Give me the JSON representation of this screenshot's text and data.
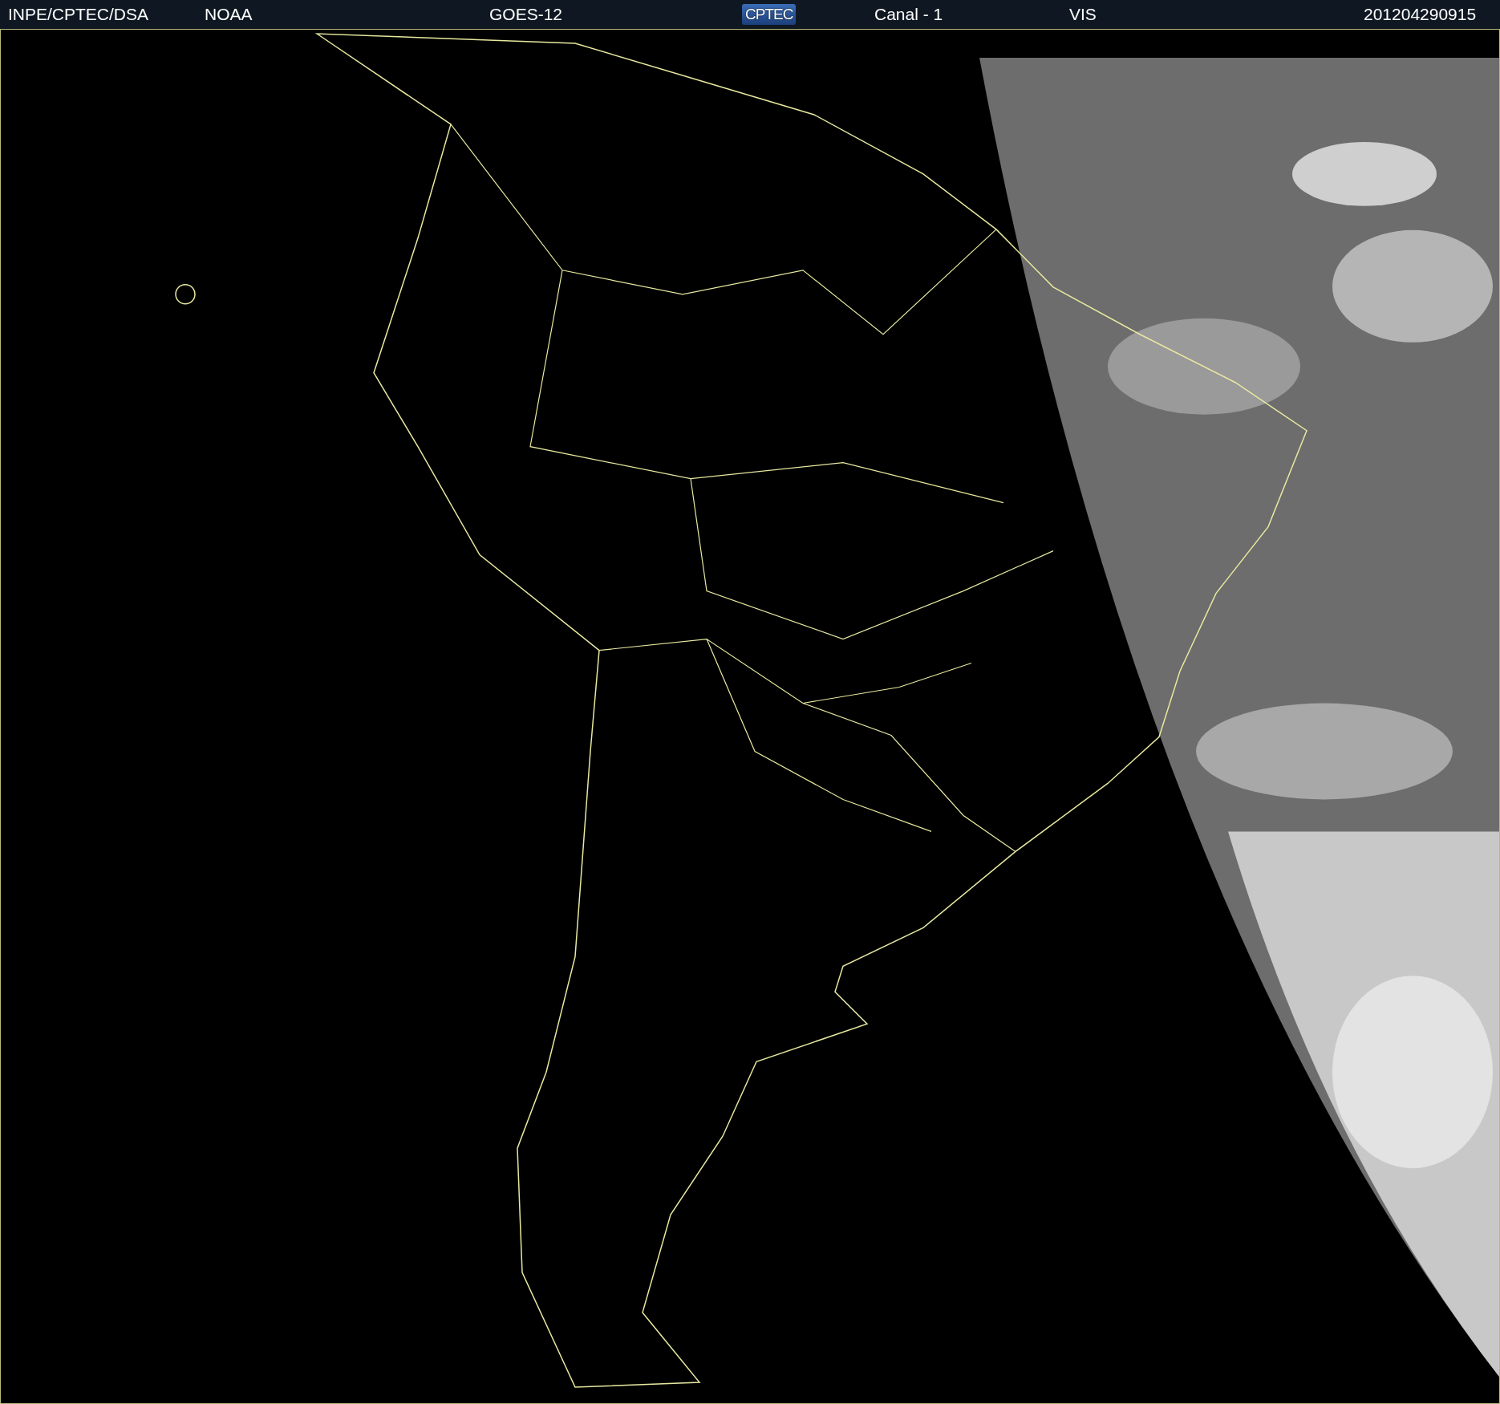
{
  "header": {
    "items": [
      {
        "kind": "text",
        "label": "INPE/CPTEC/DSA"
      },
      {
        "kind": "text",
        "label": "NOAA"
      },
      {
        "kind": "text",
        "label": "GOES-12"
      },
      {
        "kind": "logo",
        "label": "CPTEC"
      },
      {
        "kind": "text",
        "label": "Canal - 1"
      },
      {
        "kind": "text",
        "label": "VIS"
      },
      {
        "kind": "text",
        "label": "201204290915"
      }
    ]
  }
}
